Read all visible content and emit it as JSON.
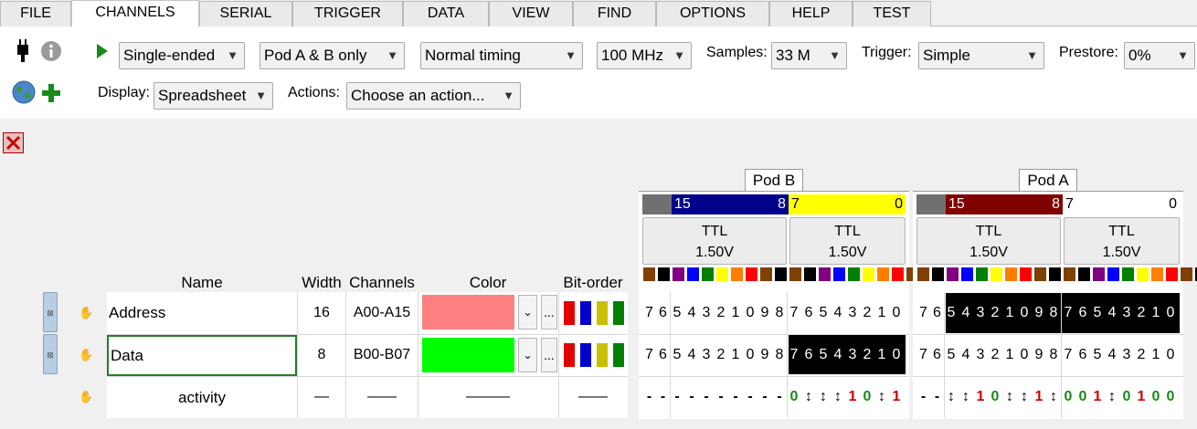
{
  "tabs": [
    "FILE",
    "CHANNELS",
    "SERIAL",
    "TRIGGER",
    "DATA",
    "VIEW",
    "FIND",
    "OPTIONS",
    "HELP",
    "TEST"
  ],
  "toolbar": {
    "mode": "Single-ended",
    "pods": "Pod A & B only",
    "timing": "Normal timing",
    "rate": "100 MHz",
    "samples_label": "Samples:",
    "samples": "33 M",
    "trigger_label": "Trigger:",
    "trigger": "Simple",
    "prestore_label": "Prestore:",
    "prestore": "0%",
    "display_label": "Display:",
    "display": "Spreadsheet",
    "actions_label": "Actions:",
    "actions": "Choose an action..."
  },
  "table": {
    "headers": {
      "name": "Name",
      "width": "Width",
      "channels": "Channels",
      "color": "Color",
      "bitorder": "Bit-order"
    },
    "rows": [
      {
        "name": "Address",
        "width": "16",
        "channels": "A00-A15",
        "color": "#ff8080"
      },
      {
        "name": "Data",
        "width": "8",
        "channels": "B00-B07",
        "color": "#00ff00"
      },
      {
        "name": "activity",
        "width": "—",
        "channels": "——",
        "color": "———",
        "bitorder": "——"
      }
    ],
    "more_button": "..."
  },
  "podB": {
    "label": "Pod B",
    "bar_left_hi": "15",
    "bar_left_lo": "8",
    "bar_right_hi": "7",
    "bar_right_lo": "0",
    "ttl": [
      "TTL",
      "TTL"
    ],
    "volt": [
      "1.50V",
      "1.50V"
    ],
    "row_address": [
      "7",
      "6",
      "5",
      "4",
      "3",
      "2",
      "1",
      "0",
      "9",
      "8",
      "7",
      "6",
      "5",
      "4",
      "3",
      "2",
      "1",
      "0"
    ],
    "row_data": [
      "7",
      "6",
      "5",
      "4",
      "3",
      "2",
      "1",
      "0",
      "9",
      "8",
      "7",
      "6",
      "5",
      "4",
      "3",
      "2",
      "1",
      "0"
    ],
    "row_activity": [
      "-",
      "-",
      "-",
      "-",
      "-",
      "-",
      "-",
      "-",
      "-",
      "-",
      "0",
      "↕",
      "↕",
      "↕",
      "1",
      "0",
      "↕",
      "1",
      "0"
    ]
  },
  "podA": {
    "label": "Pod A",
    "bar_left_hi": "15",
    "bar_left_lo": "8",
    "bar_right_hi": "7",
    "bar_right_lo": "0",
    "ttl": [
      "TTL",
      "TTL"
    ],
    "volt": [
      "1.50V",
      "1.50V"
    ],
    "row_address": [
      "7",
      "6",
      "5",
      "4",
      "3",
      "2",
      "1",
      "0",
      "9",
      "8",
      "7",
      "6",
      "5",
      "4",
      "3",
      "2",
      "1",
      "0"
    ],
    "row_data": [
      "7",
      "6",
      "5",
      "4",
      "3",
      "2",
      "1",
      "0",
      "9",
      "8",
      "7",
      "6",
      "5",
      "4",
      "3",
      "2",
      "1",
      "0"
    ],
    "row_activity": [
      "-",
      "-",
      "↕",
      "↕",
      "1",
      "0",
      "↕",
      "↕",
      "1",
      "↕",
      "0",
      "0",
      "1",
      "↕",
      "0",
      "1",
      "0",
      "0"
    ]
  },
  "colors": {
    "podB_hi_bar": "#00008b",
    "podB_lo_bar": "#ffff00",
    "podA_hi_bar": "#800000",
    "podA_lo_bar": "#ffffff",
    "swatches": [
      "#804000",
      "#000000",
      "#800080",
      "#0000ff",
      "#008000",
      "#ffff00",
      "#ff8000",
      "#ff0000",
      "#804000",
      "#000000"
    ]
  },
  "icons": [
    "usb-icon",
    "info-icon",
    "run-icon",
    "globe-icon",
    "add-icon",
    "close-icon"
  ]
}
